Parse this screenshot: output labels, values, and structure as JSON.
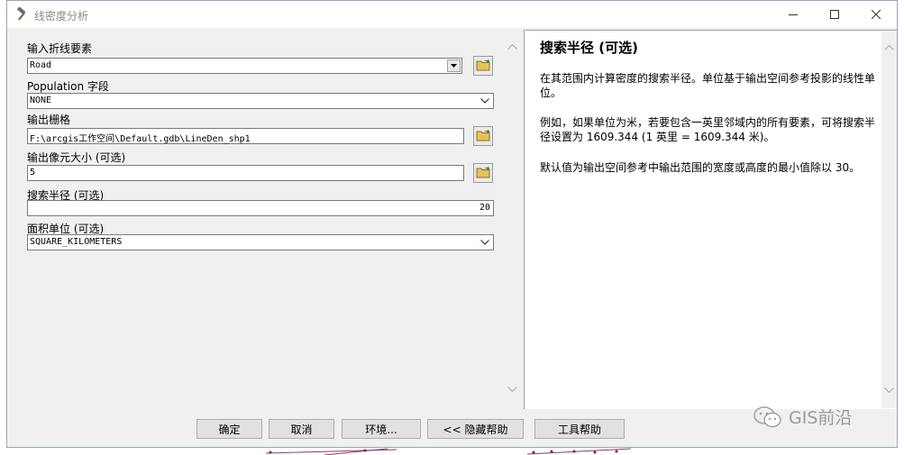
{
  "window": {
    "title": "线密度分析"
  },
  "form": {
    "input_features_label": "输入折线要素",
    "input_features_value": "Road",
    "population_label": "Population 字段",
    "population_value": "NONE",
    "output_raster_label": "输出栅格",
    "output_raster_value": "F:\\arcgis工作空间\\Default.gdb\\LineDen_shp1",
    "cell_size_label": "输出像元大小 (可选)",
    "cell_size_value": "5",
    "search_radius_label": "搜索半径 (可选)",
    "search_radius_value": "20",
    "area_units_label": "面积单位 (可选)",
    "area_units_value": "SQUARE_KILOMETERS"
  },
  "help": {
    "title": "搜索半径 (可选)",
    "p1": "在其范围内计算密度的搜索半径。单位基于输出空间参考投影的线性单位。",
    "p2": "例如，如果单位为米，若要包含一英里邻域内的所有要素，可将搜索半径设置为 1609.344 (1 英里 = 1609.344 米)。",
    "p3": "默认值为输出空间参考中输出范围的宽度或高度的最小值除以 30。"
  },
  "buttons": {
    "ok": "确定",
    "cancel": "取消",
    "environments": "环境...",
    "hide_help": "<< 隐藏帮助",
    "tool_help": "工具帮助"
  },
  "watermark": "GIS前沿",
  "icons": [
    "hammer-icon",
    "minimize-icon",
    "maximize-icon",
    "close-icon",
    "folder-open-icon",
    "chevron-down-icon",
    "wechat-icon"
  ],
  "colors": {
    "title_text": "#8a8a8a",
    "window_bg": "#f0f0f0",
    "border": "#9aa6b5"
  }
}
